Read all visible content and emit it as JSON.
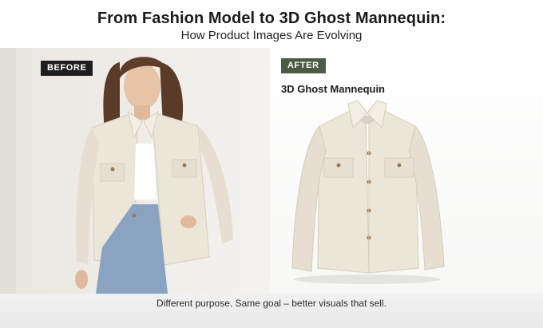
{
  "header": {
    "title": "From Fashion Model to 3D Ghost Mannequin:",
    "subtitle": "How Product Images Are Evolving"
  },
  "before_panel": {
    "badge": "BEFORE"
  },
  "after_panel": {
    "badge": "AFTER",
    "label": "3D Ghost Mannequin"
  },
  "footer": {
    "caption": "Different purpose. Same goal – better visuals that sell."
  },
  "colors": {
    "after_badge": "#4e5a45",
    "before_badge": "#1e1e1e",
    "jacket": "#ece6d9",
    "denim": "#8aa3c0"
  }
}
